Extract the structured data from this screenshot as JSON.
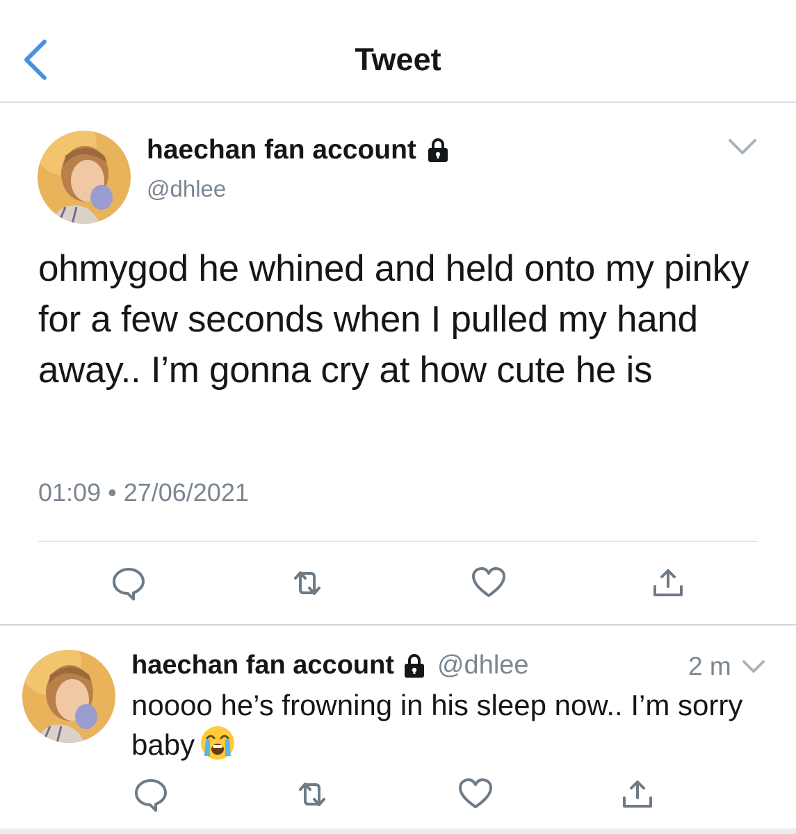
{
  "header": {
    "title": "Tweet",
    "back_icon": "chevron-left-icon"
  },
  "tweet": {
    "display_name": "haechan fan account",
    "handle": "@dhlee",
    "protected_icon": "lock-icon",
    "text": "ohmygod he whined and held onto my pinky for a few seconds when I pulled my hand away.. I’m gonna cry at how cute he is",
    "timestamp": "01:09 • 27/06/2021",
    "actions": [
      "reply-icon",
      "retweet-icon",
      "like-icon",
      "share-icon"
    ]
  },
  "reply": {
    "display_name": "haechan fan account",
    "handle": "@dhlee",
    "time": "2 m",
    "text": "noooo he’s frowning in his sleep now.. I’m sorry baby",
    "emoji": "loudly-crying-face-emoji",
    "actions": [
      "reply-icon",
      "retweet-icon",
      "like-icon",
      "share-icon"
    ]
  },
  "colors": {
    "accent": "#4a90e2",
    "text": "#14171a",
    "secondary": "#7a8691",
    "icon": "#6e7b87",
    "divider": "#e1e5e9"
  }
}
